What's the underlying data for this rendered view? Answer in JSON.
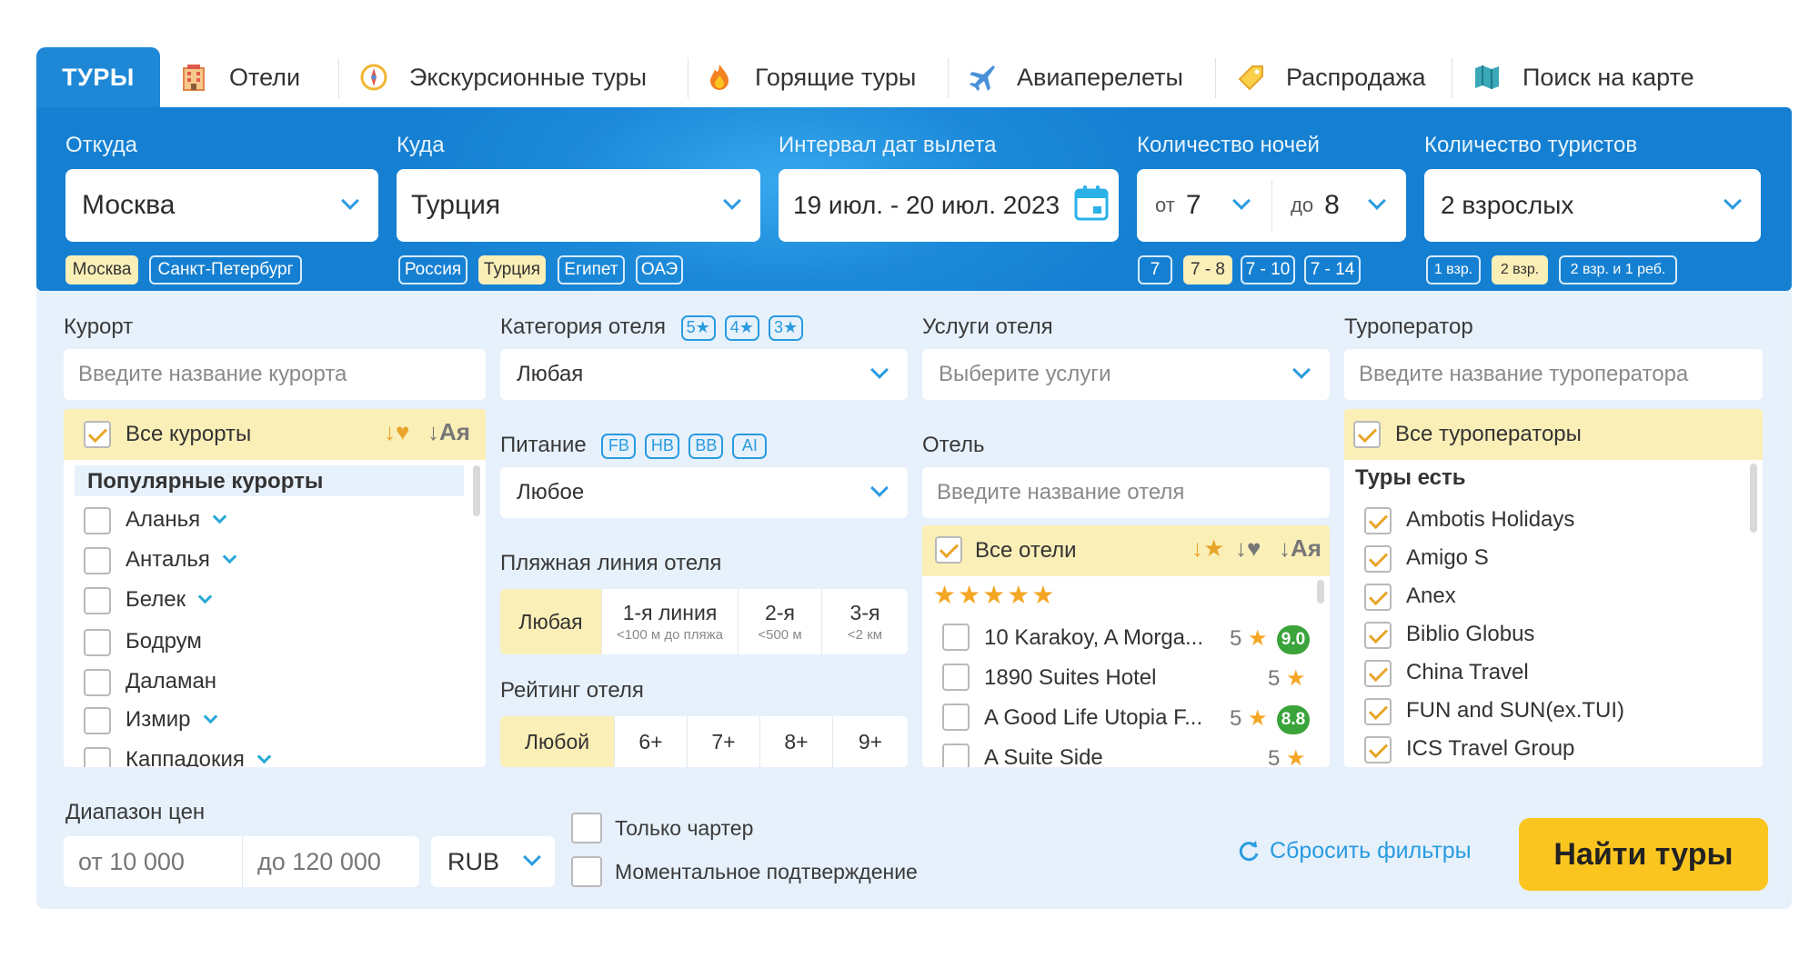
{
  "tabs": [
    {
      "label": "ТУРЫ",
      "icon": "tours-icon"
    },
    {
      "label": "Отели",
      "icon": "hotel-icon"
    },
    {
      "label": "Экскурсионные туры",
      "icon": "compass-icon"
    },
    {
      "label": "Горящие туры",
      "icon": "fire-icon"
    },
    {
      "label": "Авиаперелеты",
      "icon": "plane-icon"
    },
    {
      "label": "Распродажа",
      "icon": "tag-icon"
    },
    {
      "label": "Поиск на карте",
      "icon": "map-icon"
    }
  ],
  "search": {
    "from": {
      "label": "Откуда",
      "value": "Москва",
      "quick": [
        "Москва",
        "Санкт-Петербург"
      ],
      "selected": "Москва"
    },
    "to": {
      "label": "Куда",
      "value": "Турция",
      "quick": [
        "Россия",
        "Турция",
        "Египет",
        "ОАЭ"
      ],
      "selected": "Турция"
    },
    "dates": {
      "label": "Интервал дат вылета",
      "value": "19 июл. - 20 июл. 2023"
    },
    "nights": {
      "label": "Количество ночей",
      "from_prefix": "от",
      "from_value": "7",
      "to_prefix": "до",
      "to_value": "8",
      "quick": [
        "7",
        "7 - 8",
        "7 - 10",
        "7 - 14"
      ],
      "selected": "7 - 8"
    },
    "tourists": {
      "label": "Количество туристов",
      "value": "2 взрослых",
      "quick": [
        "1 взр.",
        "2 взр.",
        "2 взр. и 1 реб."
      ],
      "selected": "2 взр."
    }
  },
  "filters": {
    "resort": {
      "label": "Курорт",
      "placeholder": "Введите название курорта",
      "all_label": "Все курорты",
      "sort_labels": [
        "↓♥",
        "↓Ая"
      ],
      "group": "Популярные курорты",
      "items": [
        {
          "name": "Аланья",
          "expand": true
        },
        {
          "name": "Анталья",
          "expand": true
        },
        {
          "name": "Белек",
          "expand": true
        },
        {
          "name": "Бодрум",
          "expand": false
        },
        {
          "name": "Даламан",
          "expand": false
        },
        {
          "name": "Измир",
          "expand": true
        },
        {
          "name": "Каппадокия",
          "expand": true
        }
      ]
    },
    "category": {
      "label": "Категория отеля",
      "badges": [
        "5★",
        "4★",
        "3★"
      ],
      "value": "Любая"
    },
    "meal": {
      "label": "Питание",
      "badges": [
        "FB",
        "HB",
        "BB",
        "AI"
      ],
      "value": "Любое"
    },
    "beach": {
      "label": "Пляжная линия отеля",
      "options": [
        {
          "main": "Любая",
          "sub": ""
        },
        {
          "main": "1-я линия",
          "sub": "<100 м до пляжа"
        },
        {
          "main": "2-я",
          "sub": "<500 м"
        },
        {
          "main": "3-я",
          "sub": "<2 км"
        }
      ]
    },
    "rating": {
      "label": "Рейтинг отеля",
      "options": [
        "Любой",
        "6+",
        "7+",
        "8+",
        "9+"
      ]
    },
    "services": {
      "label": "Услуги отеля",
      "placeholder": "Выберите услуги"
    },
    "hotel": {
      "label": "Отель",
      "placeholder": "Введите название отеля",
      "all_label": "Все отели",
      "sort_labels": [
        "↓★",
        "↓♥",
        "↓Ая"
      ],
      "group_stars": "★★★★★",
      "items": [
        {
          "name": "10 Karakoy, A Morga...",
          "stars": "5",
          "rating": "9.0"
        },
        {
          "name": "1890 Suites Hotel",
          "stars": "5",
          "rating": ""
        },
        {
          "name": "A Good Life Utopia F...",
          "stars": "5",
          "rating": "8.8"
        },
        {
          "name": "A Suite Side",
          "stars": "5",
          "rating": ""
        }
      ]
    },
    "operator": {
      "label": "Туроператор",
      "placeholder": "Введите название туроператора",
      "all_label": "Все туроператоры",
      "group": "Туры есть",
      "items": [
        "Ambotis Holidays",
        "Amigo S",
        "Anex",
        "Biblio Globus",
        "China Travel",
        "FUN and SUN(ex.TUI)",
        "ICS Travel Group"
      ]
    },
    "price": {
      "label": "Диапазон цен",
      "from": "от 10 000",
      "to": "до 120 000",
      "currency": "RUB"
    },
    "charter_label": "Только чартер",
    "instant_label": "Моментальное подтверждение",
    "reset_label": "Сбросить фильтры",
    "search_button": "Найти туры"
  },
  "colors": {
    "primary": "#1e88d6",
    "accent": "#fbc520",
    "highlight": "#fbefb8",
    "panel": "#e6f1fc",
    "rating": "#3aa33a",
    "star": "#f5a623"
  }
}
